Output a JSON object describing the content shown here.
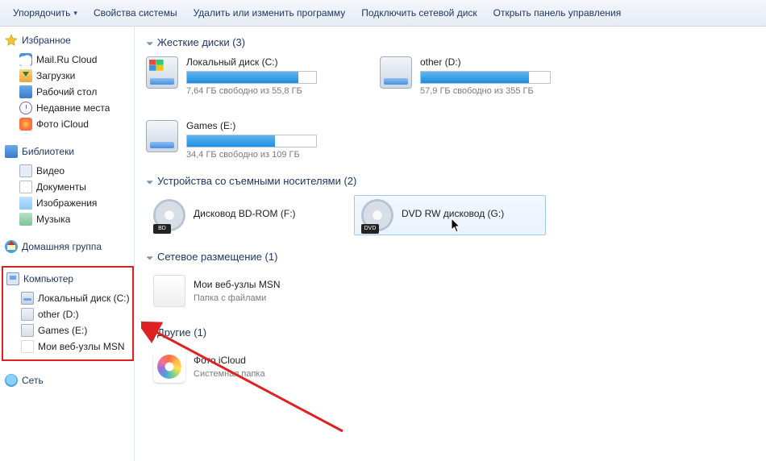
{
  "toolbar": {
    "organize": "Упорядочить",
    "items": [
      "Свойства системы",
      "Удалить или изменить программу",
      "Подключить сетевой диск",
      "Открыть панель управления"
    ]
  },
  "sidebar": {
    "favorites": {
      "label": "Избранное",
      "items": [
        "Mail.Ru Cloud",
        "Загрузки",
        "Рабочий стол",
        "Недавние места",
        "Фото iCloud"
      ]
    },
    "libraries": {
      "label": "Библиотеки",
      "items": [
        "Видео",
        "Документы",
        "Изображения",
        "Музыка"
      ]
    },
    "homegroup": {
      "label": "Домашняя группа"
    },
    "computer": {
      "label": "Компьютер",
      "items": [
        "Локальный диск (C:)",
        "other (D:)",
        "Games (E:)",
        "Мои веб-узлы MSN"
      ]
    },
    "network": {
      "label": "Сеть"
    }
  },
  "sections": {
    "hdd": {
      "title": "Жесткие диски (3)"
    },
    "remov": {
      "title": "Устройства со съемными носителями (2)"
    },
    "net": {
      "title": "Сетевое размещение (1)"
    },
    "other": {
      "title": "Другие (1)"
    }
  },
  "drives": [
    {
      "title": "Локальный диск (C:)",
      "free": "7,64 ГБ свободно из 55,8 ГБ",
      "fill_pct": 86
    },
    {
      "title": "other (D:)",
      "free": "57,9 ГБ свободно из 355 ГБ",
      "fill_pct": 84
    },
    {
      "title": "Games (E:)",
      "free": "34,4 ГБ свободно из 109 ГБ",
      "fill_pct": 68
    }
  ],
  "removables": [
    {
      "title": "Дисковод BD-ROM (F:)"
    },
    {
      "title": "DVD RW дисковод (G:)"
    }
  ],
  "netloc": {
    "title": "Мои веб-узлы MSN",
    "sub": "Папка с файлами"
  },
  "otheritem": {
    "title": "Фото iCloud",
    "sub": "Системная папка"
  }
}
